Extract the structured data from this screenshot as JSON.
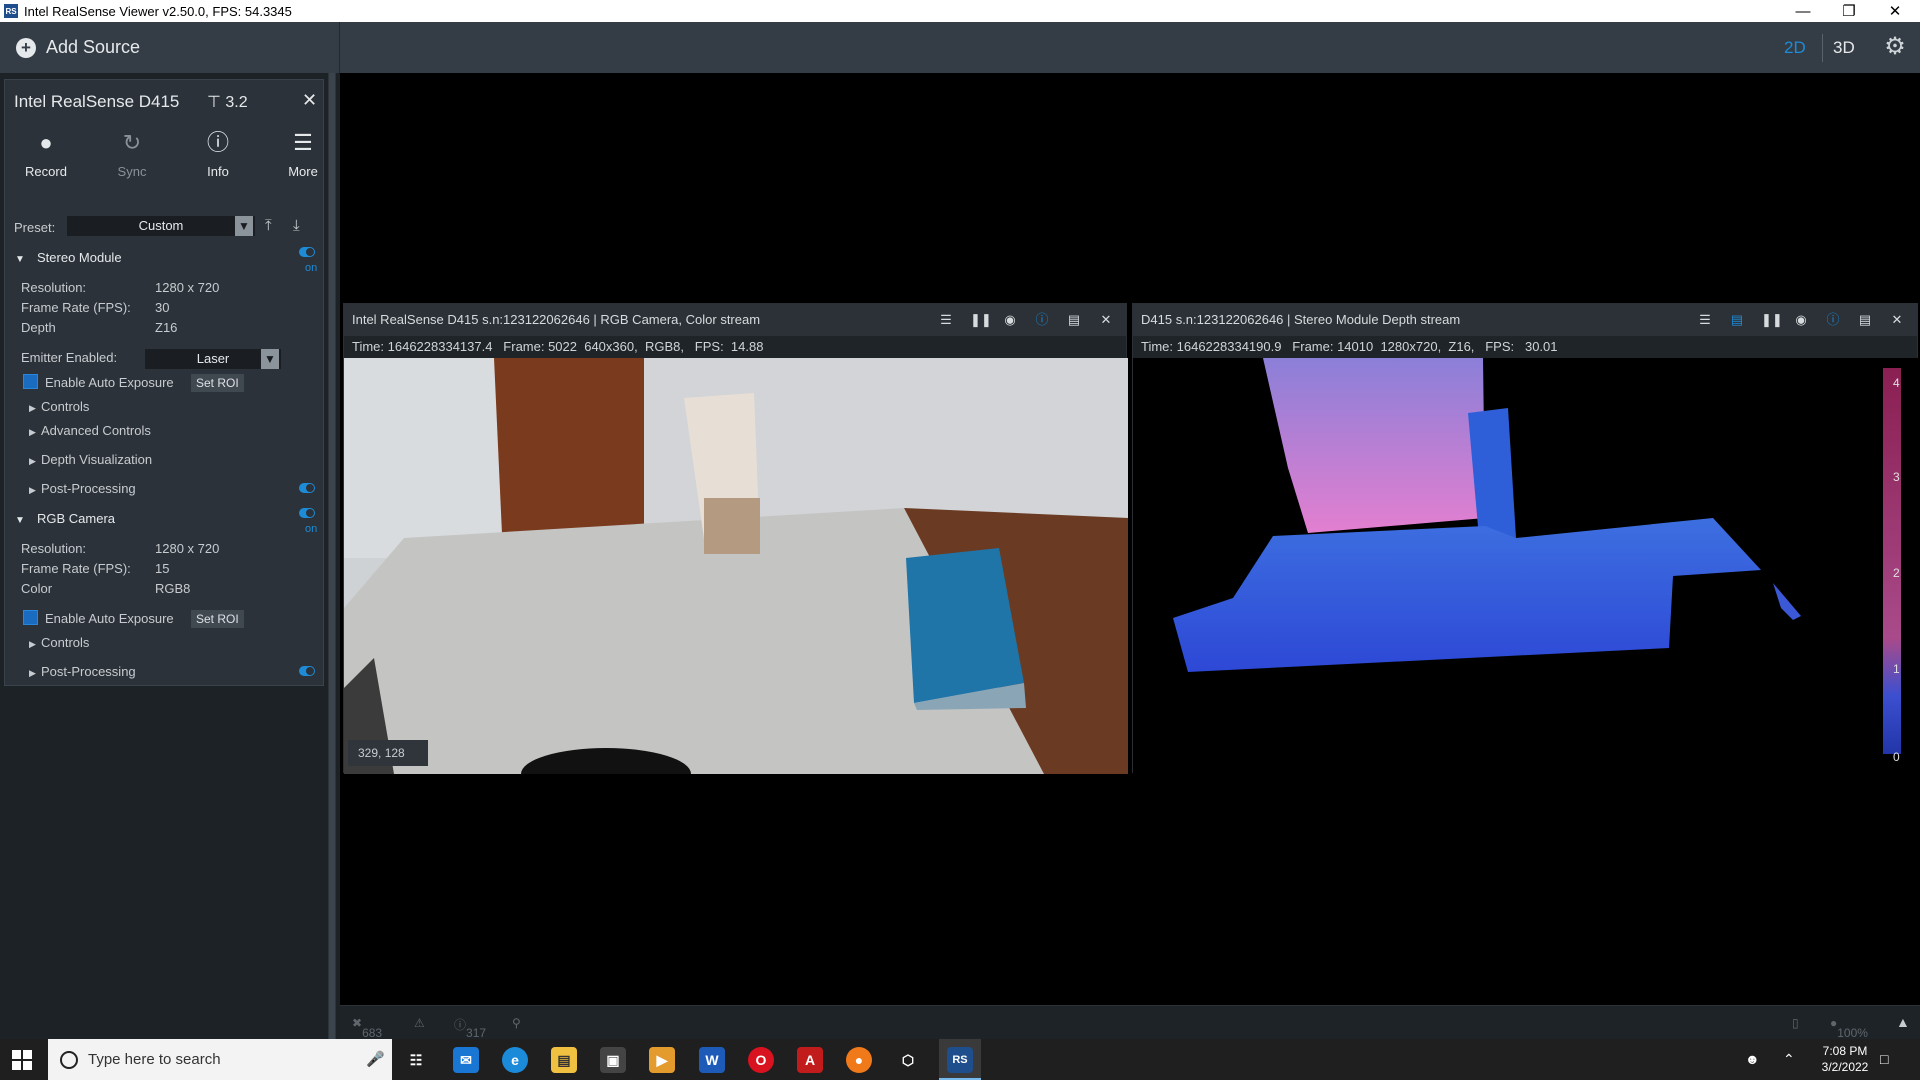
{
  "window": {
    "title": "Intel RealSense Viewer v2.50.0, FPS: 54.3345",
    "app_icon": "RS"
  },
  "topbar": {
    "add_source_label": "Add Source",
    "mode_2d": "2D",
    "mode_3d": "3D",
    "active_mode": "2D"
  },
  "device": {
    "name": "Intel RealSense D415",
    "usb": "3.2",
    "toolbar": {
      "record": "Record",
      "sync": "Sync",
      "info": "Info",
      "more": "More"
    },
    "preset_label": "Preset:",
    "preset_value": "Custom",
    "stereo": {
      "title": "Stereo Module",
      "on": "on",
      "resolution_label": "Resolution:",
      "resolution": "1280 x 720",
      "fps_label": "Frame Rate (FPS):",
      "fps": "30",
      "depth_label": "Depth",
      "depth": "Z16",
      "emitter_label": "Emitter Enabled:",
      "emitter": "Laser",
      "auto_exposure": "Enable Auto Exposure",
      "set_roi": "Set ROI",
      "controls": "Controls",
      "advanced": "Advanced Controls",
      "depth_vis": "Depth Visualization",
      "post": "Post-Processing"
    },
    "rgb": {
      "title": "RGB Camera",
      "on": "on",
      "resolution_label": "Resolution:",
      "resolution": "1280 x 720",
      "fps_label": "Frame Rate (FPS):",
      "fps": "15",
      "color_label": "Color",
      "color": "RGB8",
      "auto_exposure": "Enable Auto Exposure",
      "set_roi": "Set ROI",
      "controls": "Controls",
      "post": "Post-Processing"
    }
  },
  "color_stream": {
    "title": "Intel RealSense D415 s.n:123122062646 | RGB Camera, Color stream",
    "info": "Time: 1646228334137.4   Frame: 5022  640x360,  RGB8,   FPS:  14.88",
    "cursor_readout": "329, 128"
  },
  "depth_stream": {
    "title": "D415 s.n:123122062646 | Stereo Module Depth stream",
    "info": "Time: 1646228334190.9   Frame: 14010  1280x720,  Z16,   FPS:   30.01",
    "scale_labels": [
      "4",
      "3",
      "2",
      "1",
      "0"
    ]
  },
  "status": {
    "count_a": "683",
    "count_b": "317",
    "zoom": "100%"
  },
  "taskbar": {
    "search_placeholder": "Type here to search",
    "time": "7:08 PM",
    "date": "3/2/2022"
  },
  "colors": {
    "accent": "#1e8bd6",
    "panel": "#2b3239",
    "topbar": "#343d45"
  }
}
